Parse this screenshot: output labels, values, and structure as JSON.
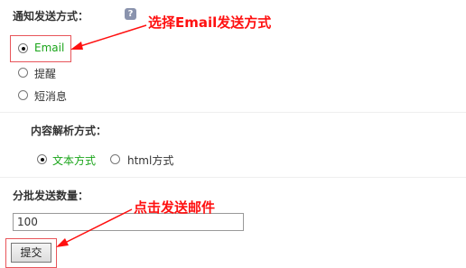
{
  "notify": {
    "label": "通知发送方式：",
    "help_icon": "?",
    "options": [
      {
        "label": "Email",
        "selected": true
      },
      {
        "label": "提醒",
        "selected": false
      },
      {
        "label": "短消息",
        "selected": false
      }
    ]
  },
  "content_parse": {
    "label": "内容解析方式：",
    "options": [
      {
        "label": "文本方式",
        "selected": true
      },
      {
        "label": "html方式",
        "selected": false
      }
    ]
  },
  "batch": {
    "label": "分批发送数量：",
    "value": "100"
  },
  "submit": {
    "label": "提交"
  },
  "annotations": {
    "select_email": "选择Email发送方式",
    "click_send": "点击发送邮件"
  },
  "colors": {
    "annotation": "#ff1010",
    "selected_text": "#1aa51a",
    "highlight_border": "#e8555a"
  }
}
